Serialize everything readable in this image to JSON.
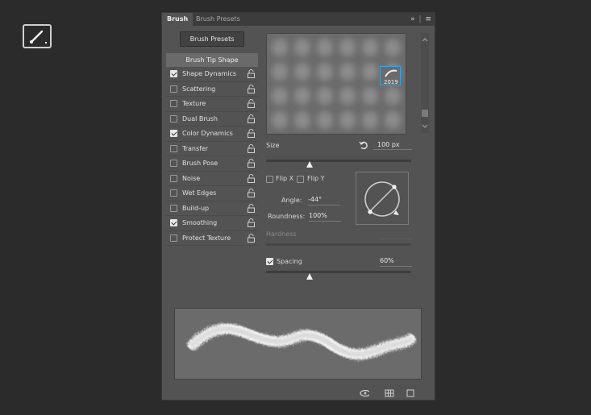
{
  "tool": {
    "icon": "brush-icon"
  },
  "tabs": [
    {
      "label": "Brush",
      "active": true
    },
    {
      "label": "Brush Presets",
      "active": false
    }
  ],
  "menu_icons": {
    "collapse": "double-chevron-right-icon",
    "menu": "hamburger-menu-icon"
  },
  "presets_button": "Brush Presets",
  "tip_shape": "Brush Tip Shape",
  "options": [
    {
      "label": "Shape Dynamics",
      "checked": true
    },
    {
      "label": "Scattering",
      "checked": false
    },
    {
      "label": "Texture",
      "checked": false
    },
    {
      "label": "Dual Brush",
      "checked": false
    },
    {
      "label": "Color Dynamics",
      "checked": true
    },
    {
      "label": "Transfer",
      "checked": false
    },
    {
      "label": "Brush Pose",
      "checked": false
    },
    {
      "label": "Noise",
      "checked": false
    },
    {
      "label": "Wet Edges",
      "checked": false
    },
    {
      "label": "Build-up",
      "checked": false
    },
    {
      "label": "Smoothing",
      "checked": true
    },
    {
      "label": "Protect Texture",
      "checked": false
    }
  ],
  "selected_preset": {
    "number": "2019"
  },
  "size": {
    "label": "Size",
    "value": "100 px",
    "slider_fraction": 0.3
  },
  "flip_x": {
    "label": "Flip X",
    "checked": false
  },
  "flip_y": {
    "label": "Flip Y",
    "checked": false
  },
  "angle": {
    "label": "Angle:",
    "value": "-44°"
  },
  "roundness": {
    "label": "Roundness:",
    "value": "100%"
  },
  "hardness": {
    "label": "Hardness",
    "enabled": false
  },
  "spacing": {
    "label": "Spacing",
    "checked": true,
    "value": "60%",
    "slider_fraction": 0.3
  },
  "colors": {
    "panel": "#535353",
    "accent": "#3aa0e0",
    "background": "#2b2b2b"
  },
  "bottom_icons": [
    "eye-brush-icon",
    "grid-icon",
    "new-preset-icon"
  ]
}
